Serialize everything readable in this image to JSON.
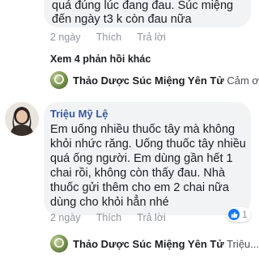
{
  "top_comment": {
    "lines": [
      "quá đúng lúc đang đau. Súc miệng",
      "đến ngày t3 k còn đau nữa"
    ],
    "time": "2 ngày",
    "like": "Thích",
    "reply": "Trả lời"
  },
  "view_more_replies": "Xem 4 phản hồi khác",
  "reply_preview_1": {
    "author": "Thảo Dược Súc Miệng Yên Tử",
    "snippet": "Cảm ơ..."
  },
  "comment_2": {
    "author": "Triệu Mỹ Lệ",
    "lines": [
      "Em uống nhiều thuốc tây mà không",
      "khỏi nhức răng. Uống thuốc tây nhiều",
      "quá ống người. Em dùng gần hết 1",
      "chai rồi, không còn thấy đau. Nhà",
      "thuốc gửi thêm cho em 2 chai nữa",
      "dùng cho khỏi hẳn nhé"
    ],
    "time": "2 ngày",
    "like": "Thích",
    "reply": "Trả lời",
    "reaction_count": "1"
  },
  "reply_preview_2": {
    "author": "Thảo Dược Súc Miệng Yên Tử",
    "snippet": "Triệu..."
  },
  "colors": {
    "bubble": "#f2f3f5",
    "name_link": "#385898",
    "meta": "#90949c",
    "like_blue": "#1877f2"
  }
}
